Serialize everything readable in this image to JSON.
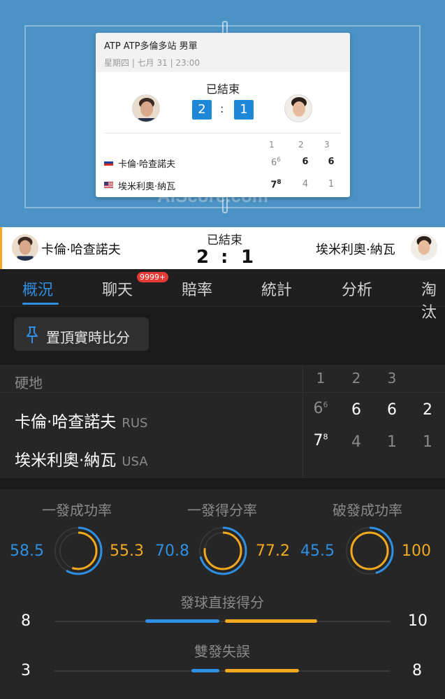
{
  "card": {
    "tournament": "ATP ATP多倫多站 男單",
    "date": "星期四 | 七月 31 | 23:00",
    "status": "已結束",
    "score_home": "2",
    "score_away": "1",
    "set_headers": [
      "1",
      "2",
      "3"
    ],
    "players": [
      {
        "name": "卡倫·哈查諾夫",
        "flag": "russia-flag-icon",
        "sets": [
          {
            "v": "6",
            "tb": "6"
          },
          {
            "v": "6",
            "tb": ""
          },
          {
            "v": "6",
            "tb": ""
          }
        ]
      },
      {
        "name": "埃米利奧·納瓦",
        "flag": "usa-flag-icon",
        "sets": [
          {
            "v": "7",
            "tb": "8"
          },
          {
            "v": "4",
            "tb": ""
          },
          {
            "v": "1",
            "tb": ""
          }
        ]
      }
    ]
  },
  "watermark": "AiScore.com",
  "scorebar": {
    "home_name": "卡倫·哈查諾夫",
    "away_name": "埃米利奧·納瓦",
    "status": "已結束",
    "home_score": "2",
    "colon": ":",
    "away_score": "1"
  },
  "tabs": [
    "概況",
    "聊天",
    "賠率",
    "統計",
    "分析",
    "淘汰"
  ],
  "chat_badge": "9999+",
  "pin_button": "置頂實時比分",
  "set_table": {
    "surface": "硬地",
    "headers": [
      "1",
      "2",
      "3"
    ],
    "players": [
      {
        "name": "卡倫·哈查諾夫",
        "country": "RUS",
        "sets": [
          {
            "v": "6",
            "tb": "6"
          },
          {
            "v": "6",
            "tb": ""
          },
          {
            "v": "6",
            "tb": ""
          }
        ],
        "total": "2"
      },
      {
        "name": "埃米利奧·納瓦",
        "country": "USA",
        "sets": [
          {
            "v": "7",
            "tb": "8"
          },
          {
            "v": "4",
            "tb": ""
          },
          {
            "v": "1",
            "tb": ""
          }
        ],
        "total": "1"
      }
    ]
  },
  "stats": {
    "rings": [
      {
        "title": "一發成功率",
        "home": "58.5",
        "away": "55.3",
        "home_pct": 58.5,
        "away_pct": 55.3
      },
      {
        "title": "一發得分率",
        "home": "70.8",
        "away": "77.2",
        "home_pct": 70.8,
        "away_pct": 77.2
      },
      {
        "title": "破發成功率",
        "home": "45.5",
        "away": "100",
        "home_pct": 45.5,
        "away_pct": 100
      }
    ],
    "bars": [
      {
        "title": "發球直接得分",
        "home": "8",
        "away": "10",
        "home_val": 8,
        "away_val": 10
      },
      {
        "title": "雙發失誤",
        "home": "3",
        "away": "8",
        "home_val": 3,
        "away_val": 8
      }
    ]
  },
  "colors": {
    "blue": "#2f8fe3",
    "yellow": "#f2a91f",
    "court": "#4b93c4"
  }
}
